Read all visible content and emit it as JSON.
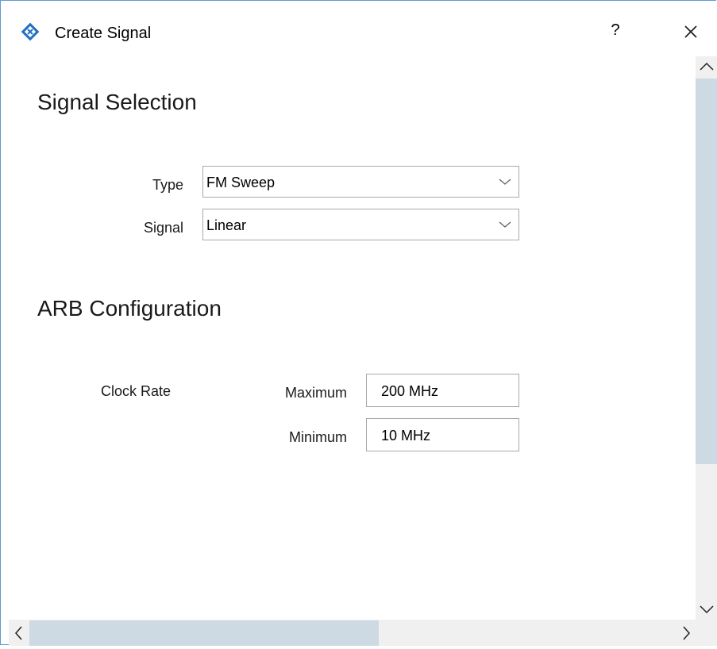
{
  "window": {
    "title": "Create Signal",
    "help_label": "?",
    "colors": {
      "border": "#5b9bd5",
      "scroll_thumb": "#cdd9e3",
      "brand": "#1f6fc4"
    }
  },
  "signal_selection": {
    "heading": "Signal Selection",
    "type_label": "Type",
    "type_value": "FM Sweep",
    "signal_label": "Signal",
    "signal_value": "Linear"
  },
  "arb_configuration": {
    "heading": "ARB Configuration",
    "clock_rate_label": "Clock Rate",
    "maximum_label": "Maximum",
    "maximum_value": "200 MHz",
    "minimum_label": "Minimum",
    "minimum_value": "10 MHz"
  },
  "icons": {
    "app": "rohde-schwarz-diamond-icon",
    "close": "close-icon",
    "dropdown": "chevron-down-icon",
    "scroll_up": "chevron-up-icon",
    "scroll_down": "chevron-down-icon",
    "scroll_left": "chevron-left-icon",
    "scroll_right": "chevron-right-icon"
  }
}
